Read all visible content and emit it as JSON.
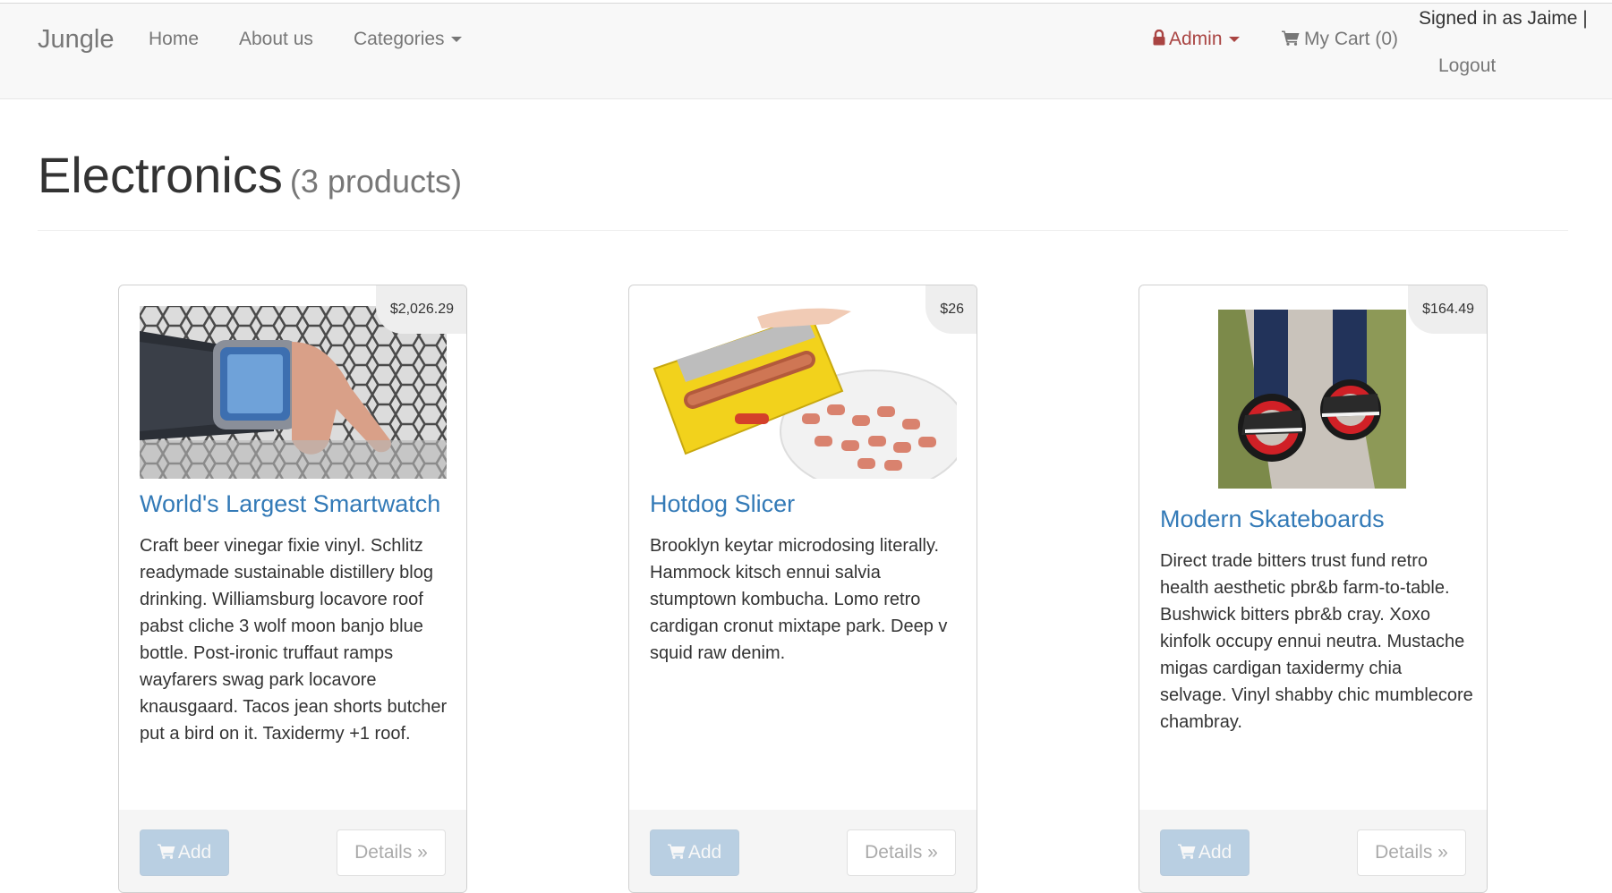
{
  "navbar": {
    "brand": "Jungle",
    "home": "Home",
    "about": "About us",
    "categories": "Categories",
    "admin": "Admin",
    "cart": "My Cart (0)",
    "signed_in": "Signed in as Jaime |",
    "logout": "Logout"
  },
  "header": {
    "title": "Electronics",
    "count": "(3 products)"
  },
  "products": [
    {
      "price": "$2,026.29",
      "name": "World's Largest Smartwatch",
      "description": "Craft beer vinegar fixie vinyl. Schlitz readymade sustainable distillery blog drinking. Williamsburg locavore roof pabst cliche 3 wolf moon banjo blue bottle. Post-ironic truffaut ramps wayfarers swag park locavore knausgaard. Tacos jean shorts butcher put a bird on it. Taxidermy +1 roof.",
      "add_label": "Add",
      "details_label": "Details »"
    },
    {
      "price": "$26",
      "name": "Hotdog Slicer",
      "description": "Brooklyn keytar microdosing literally. Hammock kitsch ennui salvia stumptown kombucha. Lomo retro cardigan cronut mixtape park. Deep v squid raw denim.",
      "add_label": "Add",
      "details_label": "Details »"
    },
    {
      "price": "$164.49",
      "name": "Modern Skateboards",
      "description": "Direct trade bitters trust fund retro health aesthetic pbr&b farm-to-table. Bushwick bitters pbr&b cray. Xoxo kinfolk occupy ennui neutra. Mustache migas cardigan taxidermy chia selvage. Vinyl shabby chic mumblecore chambray.",
      "add_label": "Add",
      "details_label": "Details »"
    }
  ],
  "colors": {
    "link": "#337ab7",
    "admin": "#a94442",
    "navbar_bg": "#f8f8f8"
  },
  "icons": {
    "lock": "lock-icon",
    "cart": "cart-icon",
    "caret": "caret-down-icon"
  }
}
